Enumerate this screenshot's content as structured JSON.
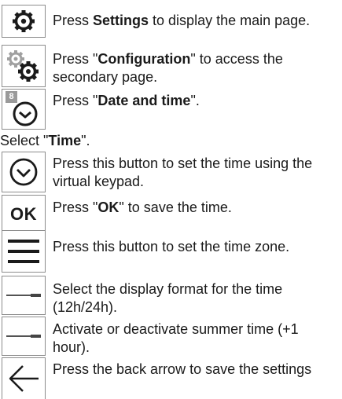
{
  "steps": [
    {
      "prefix": "Press ",
      "bold": "Settings",
      "suffix": " to display the main page."
    },
    {
      "prefix": "Press \"",
      "bold": "Configuration",
      "suffix": "\" to access the",
      "line2": "secondary page."
    },
    {
      "prefix": "Press \"",
      "bold": "Date and time",
      "suffix": "\".",
      "badge": "8"
    },
    {
      "prefix": "Select \"",
      "bold": "Time",
      "suffix": "\"."
    },
    {
      "text": "Press this button to set the time using the",
      "line2": "virtual keypad."
    },
    {
      "prefix": "Press \"",
      "bold": "OK",
      "suffix": "\" to save the time.",
      "icon_label": "OK"
    },
    {
      "text": "Press this button to set the time zone."
    },
    {
      "text": "Select the display format for the time",
      "line2": "(12h/24h)."
    },
    {
      "text": "Activate or deactivate summer time (+1",
      "line2": "hour)."
    },
    {
      "text": "Press the back arrow to save the settings"
    }
  ],
  "icons": [
    "gear-icon",
    "double-gear-icon",
    "clock-badge-icon",
    "chevron-down-circle-icon",
    "ok-icon",
    "hamburger-menu-icon",
    "slider-toggle-icon",
    "slider-toggle-icon",
    "back-arrow-icon"
  ]
}
